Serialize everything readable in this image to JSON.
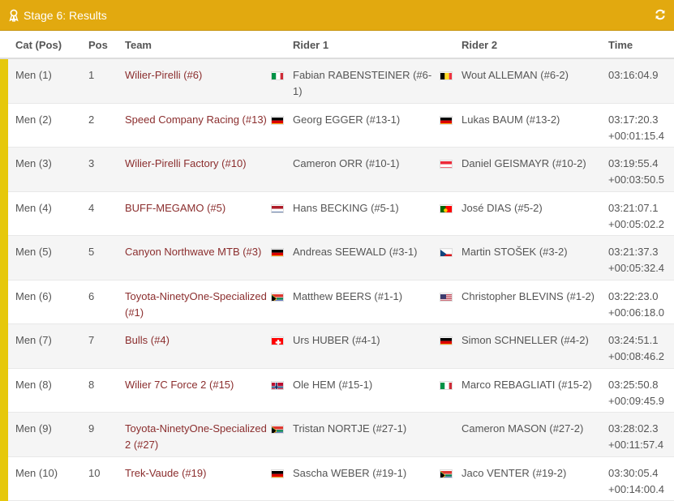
{
  "header": {
    "title": "Stage 6: Results",
    "color": "#e2a90f"
  },
  "columns": {
    "cat": "Cat (Pos)",
    "pos": "Pos",
    "team": "Team",
    "rider1": "Rider 1",
    "rider2": "Rider 2",
    "time": "Time"
  },
  "colors": {
    "team_link": "#8b2e2e",
    "accent_bar": "#e6c80b",
    "row_alt": "#f5f5f5"
  },
  "rows": [
    {
      "cat": "Men (1)",
      "pos": "1",
      "team": "Wilier-Pirelli (#6)",
      "flag1": "IT",
      "rider1": "Fabian RABENSTEINER (#6-1)",
      "flag2": "BE",
      "rider2": "Wout ALLEMAN (#6-2)",
      "time": "03:16:04.9",
      "gap": ""
    },
    {
      "cat": "Men (2)",
      "pos": "2",
      "team": "Speed Company Racing (#13)",
      "flag1": "DE",
      "rider1": "Georg EGGER (#13-1)",
      "flag2": "DE",
      "rider2": "Lukas BAUM (#13-2)",
      "time": "03:17:20.3",
      "gap": "+00:01:15.4"
    },
    {
      "cat": "Men (3)",
      "pos": "3",
      "team": "Wilier-Pirelli Factory (#10)",
      "flag1": "",
      "rider1": "Cameron ORR (#10-1)",
      "flag2": "AT",
      "rider2": "Daniel GEISMAYR (#10-2)",
      "time": "03:19:55.4",
      "gap": "+00:03:50.5"
    },
    {
      "cat": "Men (4)",
      "pos": "4",
      "team": "BUFF-MEGAMO (#5)",
      "flag1": "NL",
      "rider1": "Hans BECKING (#5-1)",
      "flag2": "PT",
      "rider2": "José DIAS (#5-2)",
      "time": "03:21:07.1",
      "gap": "+00:05:02.2"
    },
    {
      "cat": "Men (5)",
      "pos": "5",
      "team": "Canyon Northwave MTB (#3)",
      "flag1": "DE",
      "rider1": "Andreas SEEWALD (#3-1)",
      "flag2": "CZ",
      "rider2": "Martin STOŠEK (#3-2)",
      "time": "03:21:37.3",
      "gap": "+00:05:32.4"
    },
    {
      "cat": "Men (6)",
      "pos": "6",
      "team": "Toyota-NinetyOne-Specialized (#1)",
      "flag1": "ZA",
      "rider1": "Matthew BEERS (#1-1)",
      "flag2": "US",
      "rider2": "Christopher BLEVINS (#1-2)",
      "time": "03:22:23.0",
      "gap": "+00:06:18.0"
    },
    {
      "cat": "Men (7)",
      "pos": "7",
      "team": "Bulls (#4)",
      "flag1": "CH",
      "rider1": "Urs HUBER (#4-1)",
      "flag2": "DE",
      "rider2": "Simon SCHNELLER (#4-2)",
      "time": "03:24:51.1",
      "gap": "+00:08:46.2"
    },
    {
      "cat": "Men (8)",
      "pos": "8",
      "team": "Wilier 7C Force 2 (#15)",
      "flag1": "NO",
      "rider1": "Ole HEM (#15-1)",
      "flag2": "IT",
      "rider2": "Marco REBAGLIATI (#15-2)",
      "time": "03:25:50.8",
      "gap": "+00:09:45.9"
    },
    {
      "cat": "Men (9)",
      "pos": "9",
      "team": "Toyota-NinetyOne-Specialized 2 (#27)",
      "flag1": "ZA",
      "rider1": "Tristan NORTJE (#27-1)",
      "flag2": "",
      "rider2": "Cameron MASON (#27-2)",
      "time": "03:28:02.3",
      "gap": "+00:11:57.4"
    },
    {
      "cat": "Men (10)",
      "pos": "10",
      "team": "Trek-Vaude (#19)",
      "flag1": "DE",
      "rider1": "Sascha WEBER (#19-1)",
      "flag2": "ZA",
      "rider2": "Jaco VENTER (#19-2)",
      "time": "03:30:05.4",
      "gap": "+00:14:00.4"
    }
  ]
}
